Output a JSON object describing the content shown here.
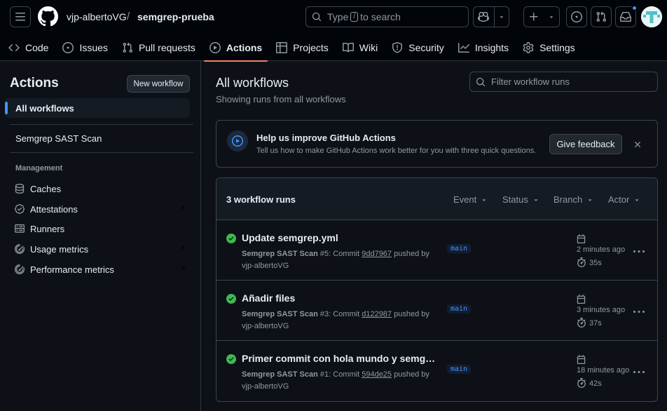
{
  "header": {
    "owner": "vjp-albertoVG",
    "separator": "/",
    "repo": "semgrep-prueba",
    "search": {
      "prefix": "Type",
      "key": "/",
      "suffix": "to search"
    }
  },
  "tabs": [
    {
      "label": "Code",
      "icon": "code-icon"
    },
    {
      "label": "Issues",
      "icon": "issue-icon"
    },
    {
      "label": "Pull requests",
      "icon": "pull-request-icon"
    },
    {
      "label": "Actions",
      "icon": "play-icon",
      "active": true
    },
    {
      "label": "Projects",
      "icon": "table-icon"
    },
    {
      "label": "Wiki",
      "icon": "book-icon"
    },
    {
      "label": "Security",
      "icon": "shield-icon"
    },
    {
      "label": "Insights",
      "icon": "graph-icon"
    },
    {
      "label": "Settings",
      "icon": "gear-icon"
    }
  ],
  "sidebar": {
    "title": "Actions",
    "new_workflow": "New workflow",
    "all_workflows": "All workflows",
    "workflow": "Semgrep SAST Scan",
    "management_heading": "Management",
    "management": [
      {
        "label": "Caches",
        "icon": "database-icon"
      },
      {
        "label": "Attestations",
        "icon": "verified-icon"
      },
      {
        "label": "Runners",
        "icon": "server-icon"
      },
      {
        "label": "Usage metrics",
        "icon": "meter-icon"
      },
      {
        "label": "Performance metrics",
        "icon": "meter-icon"
      }
    ]
  },
  "main": {
    "title": "All workflows",
    "subtitle": "Showing runs from all workflows",
    "filter_placeholder": "Filter workflow runs",
    "banner": {
      "title": "Help us improve GitHub Actions",
      "description": "Tell us how to make GitHub Actions work better for you with three quick questions.",
      "button": "Give feedback"
    },
    "runs_header": {
      "count": "3 workflow runs",
      "filters": [
        "Event",
        "Status",
        "Branch",
        "Actor"
      ]
    },
    "runs": [
      {
        "title": "Update semgrep.yml",
        "workflow": "Semgrep SAST Scan",
        "number": "#5",
        "commit_label": "Commit",
        "sha": "9dd7967",
        "pushed": "pushed by",
        "author": "vjp-albertoVG",
        "branch": "main",
        "ago": "2 minutes ago",
        "duration": "35s",
        "status": "success"
      },
      {
        "title": "Añadir files",
        "workflow": "Semgrep SAST Scan",
        "number": "#3",
        "commit_label": "Commit",
        "sha": "d122987",
        "pushed": "pushed by",
        "author": "vjp-albertoVG",
        "branch": "main",
        "ago": "3 minutes ago",
        "duration": "37s",
        "status": "success"
      },
      {
        "title": "Primer commit con hola mundo y semgrep",
        "workflow": "Semgrep SAST Scan",
        "number": "#1",
        "commit_label": "Commit",
        "sha": "594de25",
        "pushed": "pushed by",
        "author": "vjp-albertoVG",
        "branch": "main",
        "ago": "18 minutes ago",
        "duration": "42s",
        "status": "success"
      }
    ]
  },
  "colors": {
    "background": "#0d1117",
    "header": "#010409",
    "accent_tab": "#f78166",
    "link": "#4493f8",
    "success": "#3fb950"
  }
}
